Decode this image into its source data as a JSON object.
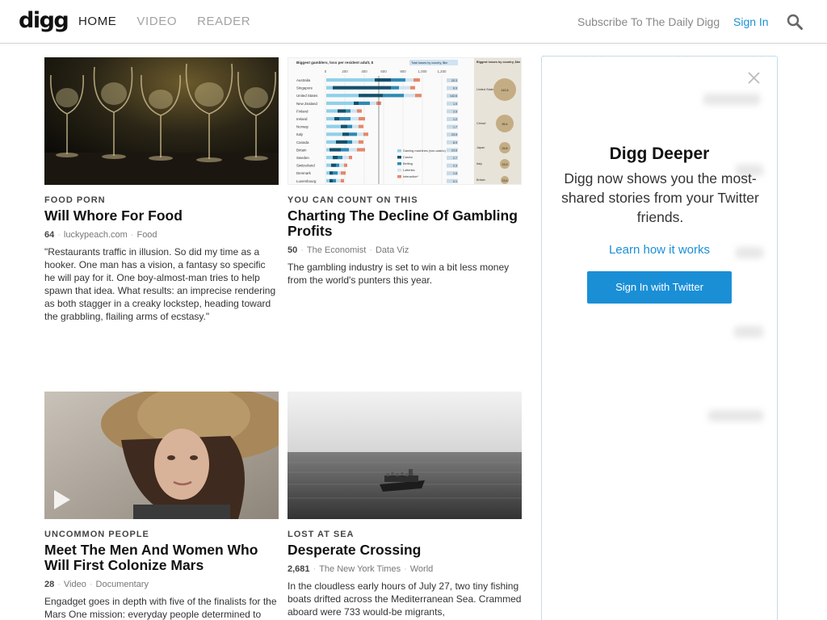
{
  "header": {
    "logo": "digg",
    "nav": [
      "HOME",
      "VIDEO",
      "READER"
    ],
    "subscribe": "Subscribe To The Daily Digg",
    "sign_in": "Sign In"
  },
  "cards": [
    {
      "kicker": "FOOD PORN",
      "title": "Will Whore For Food",
      "count": "64",
      "source": "luckypeach.com",
      "category": "Food",
      "desc": "\"Restaurants traffic in illusion. So did my time as a hooker. One man has a vision, a fantasy so specific he will pay for it. One boy-almost-man tries to help spawn that idea. What results: an imprecise rendering as both stagger in a creaky lockstep, heading toward the grabbling, flailing arms of ecstasy.\""
    },
    {
      "kicker": "YOU CAN COUNT ON THIS",
      "title": "Charting The Decline Of Gambling Profits",
      "count": "50",
      "source": "The Economist",
      "category": "Data Viz",
      "desc": "The gambling industry is set to win a bit less money from the world's punters this year."
    },
    {
      "kicker": "UNCOMMON PEOPLE",
      "title": "Meet The Men And Women Who Will First Colonize Mars",
      "count": "28",
      "source": "Video",
      "category": "Documentary",
      "desc": "Engadget goes in depth with five of the finalists for the Mars One mission: everyday people determined to"
    },
    {
      "kicker": "LOST AT SEA",
      "title": "Desperate Crossing",
      "count": "2,681",
      "source": "The New York Times",
      "category": "World",
      "desc": "In the cloudless early hours of July 27, two tiny fishing boats drifted across the Mediterranean Sea. Crammed aboard were 733 would-be migrants,"
    }
  ],
  "sidebar": {
    "title": "Digg Deeper",
    "text": "Digg now shows you the most-shared stories from your Twitter friends.",
    "learn": "Learn how it works",
    "button": "Sign In with Twitter"
  },
  "chart_thumb": {
    "title": "Biggest gamblers, loss per resident adult, $",
    "legend_title": "Total losses by country, $bn",
    "bubble_title": "Biggest losses by country, $bn",
    "ticks": [
      "0",
      "200",
      "400",
      "600",
      "800",
      "1,000",
      "1,200"
    ],
    "countries": [
      "Australia",
      "Singapore",
      "United States",
      "New Zealand",
      "Finland",
      "Ireland",
      "Norway",
      "Italy",
      "Canada",
      "Britain",
      "Sweden",
      "Switzerland",
      "Denmark",
      "Luxembourg"
    ],
    "totals": [
      "20.3",
      "6.9",
      "142.6",
      "1.9",
      "2.5",
      "1.2",
      "1.7",
      "23.9",
      "8.9",
      "23.6",
      "2.7",
      "2.3",
      "1.5",
      "0.1"
    ],
    "legend": [
      "Gaming machines (non-casino)",
      "Casino",
      "Betting",
      "Lotteries",
      "Interactive*"
    ],
    "bubbles": [
      {
        "label": "United States",
        "value": "142.6"
      },
      {
        "label": "China†",
        "value": "95.4"
      },
      {
        "label": "Japan",
        "value": "29.8"
      },
      {
        "label": "Italy",
        "value": "23.9"
      },
      {
        "label": "Britain",
        "value": "23.6"
      }
    ]
  },
  "colors": {
    "accent": "#1a8fd6",
    "text": "#111111",
    "muted": "#777777"
  }
}
